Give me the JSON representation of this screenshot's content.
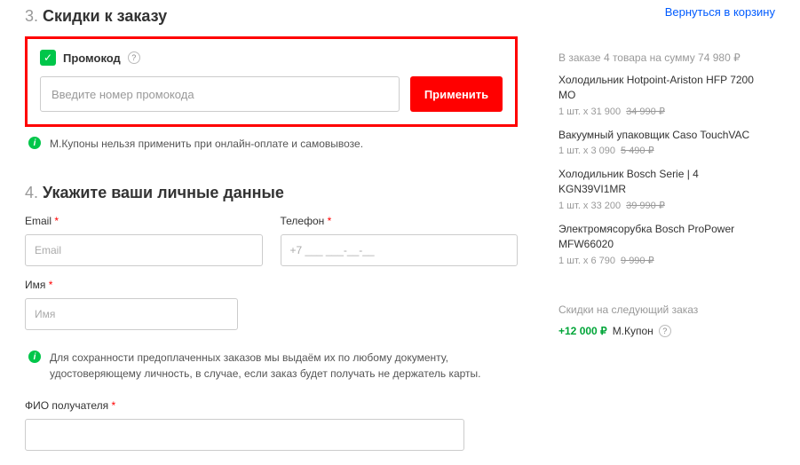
{
  "top_link": "Вернуться в корзину",
  "section3": {
    "num": "3.",
    "title": "Скидки к заказу",
    "promo_label": "Промокод",
    "promo_placeholder": "Введите номер промокода",
    "apply_label": "Применить",
    "info_text": "М.Купоны нельзя применить при онлайн-оплате и самовывозе."
  },
  "section4": {
    "num": "4.",
    "title": "Укажите ваши личные данные",
    "email_label": "Email",
    "email_placeholder": "Email",
    "phone_label": "Телефон",
    "phone_placeholder": "+7 ___ ___-__-__",
    "name_label": "Имя",
    "name_placeholder": "Имя",
    "info_text": "Для сохранности предоплаченных заказов мы выдаём их по любому документу, удостоверяющему личность, в случае, если заказ будет получать не держатель карты.",
    "fio_label": "ФИО получателя"
  },
  "order": {
    "summary": "В заказе 4 товара на сумму 74 980 ₽",
    "items": [
      {
        "name": "Холодильник Hotpoint-Ariston HFP 7200 MO",
        "qty": "1 шт. x 31 900",
        "old": "34 990 ₽"
      },
      {
        "name": "Вакуумный упаковщик Caso TouchVAC",
        "qty": "1 шт. x 3 090",
        "old": "5 490 ₽"
      },
      {
        "name": "Холодильник Bosch Serie | 4 KGN39VI1MR",
        "qty": "1 шт. x 33 200",
        "old": "39 990 ₽"
      },
      {
        "name": "Электромясорубка Bosch ProPower MFW66020",
        "qty": "1 шт. x 6 790",
        "old": "9 990 ₽"
      }
    ],
    "next_discount_label": "Скидки на следующий заказ",
    "coupon_amount": "+12 000 ₽",
    "coupon_label": "М.Купон"
  }
}
